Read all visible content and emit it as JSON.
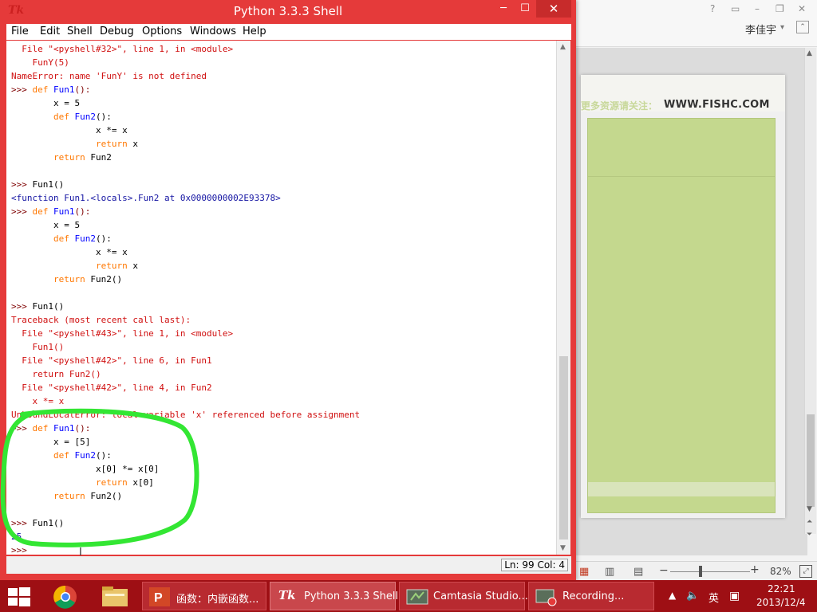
{
  "ppt": {
    "user_name": "李佳宇",
    "slide_banner_faint": "更多资源请关注：",
    "slide_banner": "WWW.FISHC.COM",
    "zoom_level": "82%"
  },
  "shell": {
    "title": "Python 3.3.3 Shell",
    "menu": [
      "File",
      "Edit",
      "Shell",
      "Debug",
      "Options",
      "Windows",
      "Help"
    ],
    "status": "Ln: 99  Col: 4",
    "lines": [
      "  File \"<pyshell#32>\", line 1, in <module>",
      "    FunY(5)",
      "NameError: name 'FunY' is not defined",
      ">>> def Fun1():",
      "        x = 5",
      "        def Fun2():",
      "                x *= x",
      "                return x",
      "        return Fun2",
      "",
      ">>> Fun1()",
      "<function Fun1.<locals>.Fun2 at 0x0000000002E93378>",
      ">>> def Fun1():",
      "        x = 5",
      "        def Fun2():",
      "                x *= x",
      "                return x",
      "        return Fun2()",
      "",
      ">>> Fun1()",
      "Traceback (most recent call last):",
      "  File \"<pyshell#43>\", line 1, in <module>",
      "    Fun1()",
      "  File \"<pyshell#42>\", line 6, in Fun1",
      "    return Fun2()",
      "  File \"<pyshell#42>\", line 4, in Fun2",
      "    x *= x",
      "UnboundLocalError: local variable 'x' referenced before assignment",
      ">>> def Fun1():",
      "        x = [5]",
      "        def Fun2():",
      "                x[0] *= x[0]",
      "                return x[0]",
      "        return Fun2()",
      "",
      ">>> Fun1()",
      "25",
      ">>> "
    ]
  },
  "taskbar": {
    "items": [
      {
        "label": "函数：内嵌函数..."
      },
      {
        "label": "Python 3.3.3 Shell"
      },
      {
        "label": "Camtasia Studio..."
      },
      {
        "label": "Recording..."
      }
    ],
    "ime": "英",
    "time": "22:21",
    "date": "2013/12/4"
  },
  "colors": {
    "title_bar": "#e53a3a",
    "taskbar": "#9e0f14",
    "highlight": "#33e633",
    "error_text": "#d01010",
    "keyword": "#ff7700",
    "def_name": "#0000ff",
    "output_text": "#1515a3"
  }
}
